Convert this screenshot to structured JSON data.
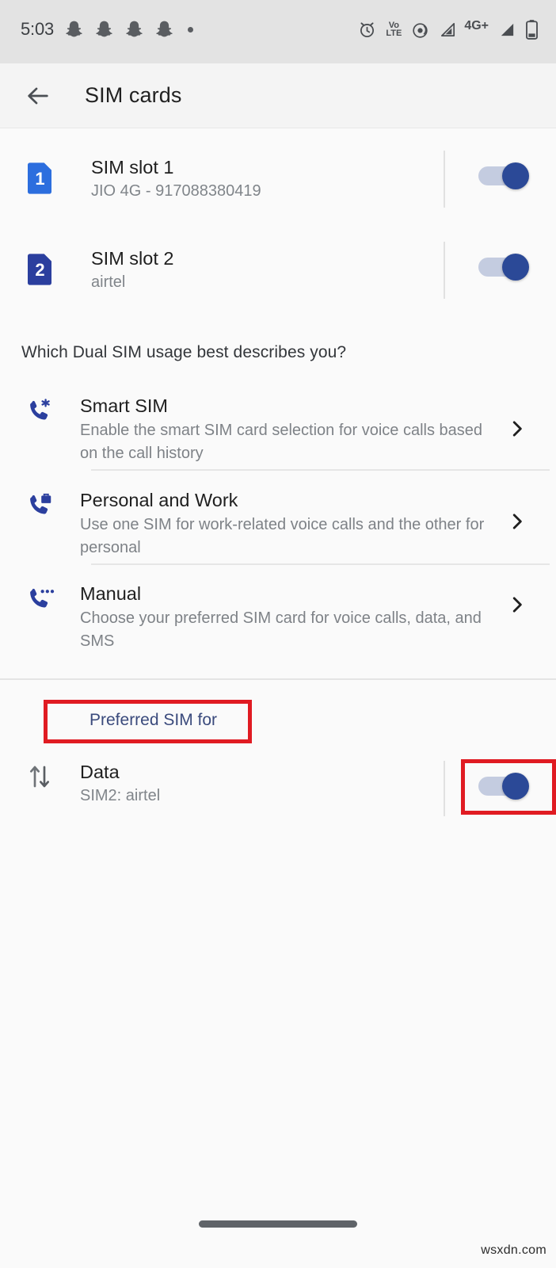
{
  "status_bar": {
    "time": "5:03",
    "left_icons": [
      "snapchat-ghost-icon",
      "snapchat-ghost-icon",
      "snapchat-ghost-icon",
      "snapchat-ghost-icon",
      "notification-dot-icon"
    ],
    "right_icons": [
      "alarm-icon",
      "volte-icon",
      "hotspot-icon",
      "signal-sim1-icon",
      "signal-sim2-icon",
      "battery-icon"
    ],
    "volte_label_top": "Vo",
    "volte_label_bottom": "LTE",
    "network_label": "4G+"
  },
  "app_bar": {
    "back_label": "back-arrow",
    "title": "SIM cards"
  },
  "sim_slots": [
    {
      "icon_number": "1",
      "title": "SIM slot 1",
      "subtitle": "JIO 4G - 917088380419",
      "toggle_on": true,
      "icon_color": "#2c6ede"
    },
    {
      "icon_number": "2",
      "title": "SIM slot 2",
      "subtitle": "airtel",
      "toggle_on": true,
      "icon_color": "#2b3f9e"
    }
  ],
  "usage_section": {
    "question": "Which Dual SIM usage best describes you?",
    "options": [
      {
        "icon": "phone-asterisk-icon",
        "title": "Smart SIM",
        "subtitle": "Enable the smart SIM card selection for voice calls based on the call history"
      },
      {
        "icon": "phone-briefcase-icon",
        "title": "Personal and Work",
        "subtitle": "Use one SIM for work-related voice calls and the other for personal"
      },
      {
        "icon": "phone-dots-icon",
        "title": "Manual",
        "subtitle": "Choose your preferred SIM card for voice calls, data, and SMS"
      }
    ]
  },
  "preferred_section": {
    "header": "Preferred SIM for",
    "rows": [
      {
        "icon": "data-transfer-icon",
        "title": "Data",
        "subtitle": "SIM2: airtel",
        "toggle_on": true
      }
    ]
  },
  "annotations": {
    "color": "#e01b22",
    "boxes": [
      "preferred-sim-for-header",
      "data-toggle"
    ]
  },
  "watermark": "wsxdn.com"
}
